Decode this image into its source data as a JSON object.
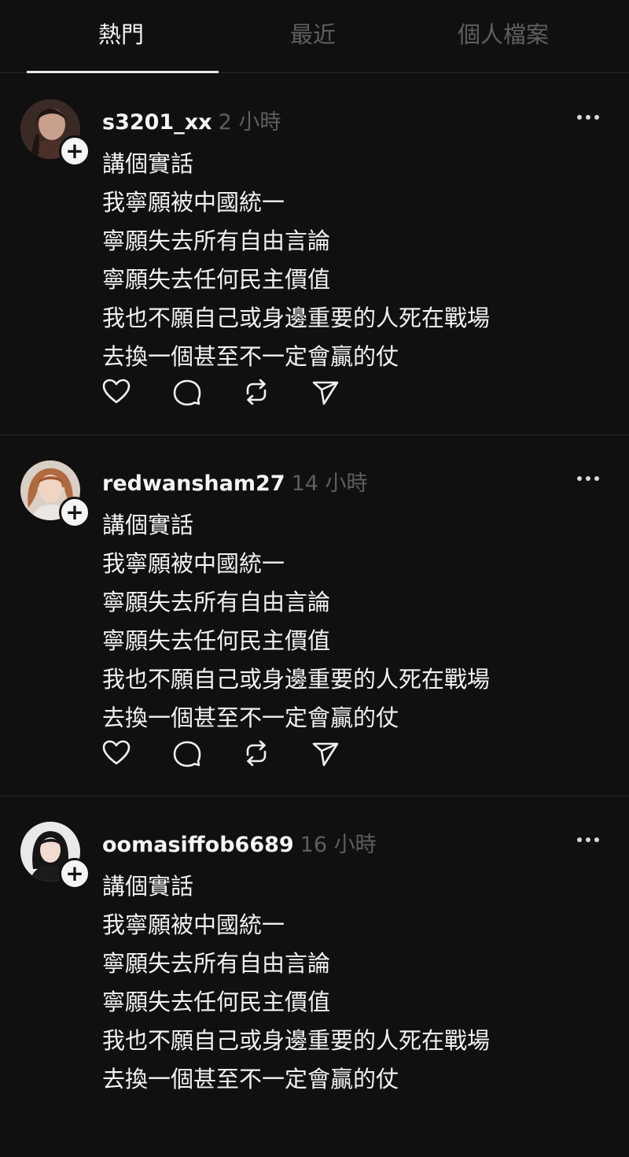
{
  "tabs": [
    {
      "label": "熱門",
      "active": true
    },
    {
      "label": "最近",
      "active": false
    },
    {
      "label": "個人檔案",
      "active": false
    }
  ],
  "posts": [
    {
      "username": "s3201_xx",
      "time": "2 小時",
      "lines": [
        "講個實話",
        "我寧願被中國統一",
        "寧願失去所有自由言論",
        "寧願失去任何民主價值",
        "我也不願自己或身邊重要的人死在戰場",
        "去換一個甚至不一定會贏的仗"
      ]
    },
    {
      "username": "redwansham27",
      "time": "14 小時",
      "lines": [
        "講個實話",
        "我寧願被中國統一",
        "寧願失去所有自由言論",
        "寧願失去任何民主價值",
        "我也不願自己或身邊重要的人死在戰場",
        "去換一個甚至不一定會贏的仗"
      ]
    },
    {
      "username": "oomasiffob6689",
      "time": "16 小時",
      "lines": [
        "講個實話",
        "我寧願被中國統一",
        "寧願失去所有自由言論",
        "寧願失去任何民主價值",
        "我也不願自己或身邊重要的人死在戰場",
        "去換一個甚至不一定會贏的仗"
      ]
    }
  ],
  "icons": {
    "follow": "plus-icon",
    "more": "more-horizontal-icon",
    "like": "heart-icon",
    "reply": "comment-icon",
    "repost": "repost-icon",
    "share": "send-icon"
  },
  "colors": {
    "background": "#101010",
    "text": "#f3f3f3",
    "muted": "#5e5e5e",
    "divider": "#2a2a2a"
  }
}
